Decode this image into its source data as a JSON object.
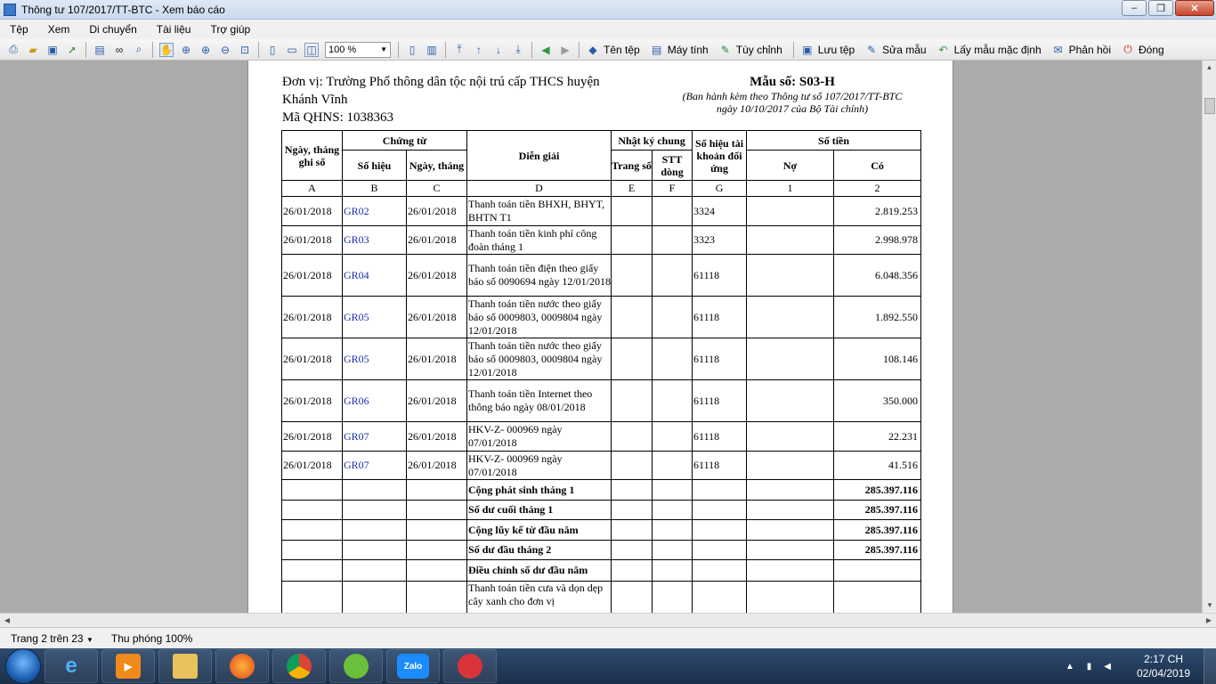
{
  "window": {
    "title": "Thông tư 107/2017/TT-BTC - Xem báo cáo",
    "minimize": "–",
    "maximize": "❐",
    "close": "✕"
  },
  "menu": [
    "Tệp",
    "Xem",
    "Di chuyển",
    "Tài liệu",
    "Trợ giúp"
  ],
  "toolbar": {
    "zoom_value": "100 %",
    "buttons": {
      "file_name": "Tên tệp",
      "computer": "Máy tính",
      "customize": "Tùy chỉnh",
      "save_file": "Lưu tệp",
      "edit_template": "Sửa mẫu",
      "default_template": "Lấy mẫu mặc định",
      "feedback": "Phản hồi",
      "close": "Đóng"
    }
  },
  "report": {
    "unit_line1": "Đơn vị: Trường Phổ thông dân tộc nội trú cấp THCS huyện",
    "unit_line2": "Khánh Vĩnh",
    "qhns": "Mã QHNS: 1038363",
    "form_no": "Mẫu số: S03-H",
    "form_note1": "(Ban hành kèm theo Thông tư số 107/2017/TT-BTC",
    "form_note2": "ngày 10/10/2017 của Bộ Tài chính)",
    "headers": {
      "date": "Ngày, tháng ghi sổ",
      "voucher": "Chứng từ",
      "voucher_no": "Số hiệu",
      "voucher_date": "Ngày, tháng",
      "description": "Diễn giải",
      "journal": "Nhật ký chung",
      "page": "Trang số",
      "stt": "STT dòng",
      "account": "Số hiệu tài khoản đối ứng",
      "amount": "Số tiền",
      "debit": "Nợ",
      "credit": "Có"
    },
    "letters": [
      "A",
      "B",
      "C",
      "D",
      "E",
      "F",
      "G",
      "1",
      "2"
    ],
    "rows": [
      {
        "date": "26/01/2018",
        "no": "GR02",
        "vdate": "26/01/2018",
        "desc": "Thanh toán tiền BHXH, BHYT, BHTN T1",
        "acc": "3324",
        "credit": "2.819.253"
      },
      {
        "date": "26/01/2018",
        "no": "GR03",
        "vdate": "26/01/2018",
        "desc": "Thanh toán tiền kinh phí công đoàn tháng 1",
        "acc": "3323",
        "credit": "2.998.978"
      },
      {
        "date": "26/01/2018",
        "no": "GR04",
        "vdate": "26/01/2018",
        "desc": "Thanh toán tiền điện theo giấy báo số 0090694 ngày 12/01/2018",
        "acc": "61118",
        "credit": "6.048.356"
      },
      {
        "date": "26/01/2018",
        "no": "GR05",
        "vdate": "26/01/2018",
        "desc": "Thanh toán tiền nước theo giấy báo số 0009803, 0009804 ngày 12/01/2018",
        "acc": "61118",
        "credit": "1.892.550"
      },
      {
        "date": "26/01/2018",
        "no": "GR05",
        "vdate": "26/01/2018",
        "desc": "Thanh toán tiền nước theo giấy báo số 0009803, 0009804 ngày 12/01/2018",
        "acc": "61118",
        "credit": "108.146"
      },
      {
        "date": "26/01/2018",
        "no": "GR06",
        "vdate": "26/01/2018",
        "desc": "Thanh toán tiền Internet theo thông báo ngày 08/01/2018",
        "acc": "61118",
        "credit": "350.000"
      },
      {
        "date": "26/01/2018",
        "no": "GR07",
        "vdate": "26/01/2018",
        "desc": "HKV-Z- 000969 ngày 07/01/2018",
        "acc": "61118",
        "credit": "22.231"
      },
      {
        "date": "26/01/2018",
        "no": "GR07",
        "vdate": "26/01/2018",
        "desc": "HKV-Z- 000969 ngày 07/01/2018",
        "acc": "61118",
        "credit": "41.516"
      }
    ],
    "summaries": [
      {
        "label": "Cộng phát sinh tháng 1",
        "credit": "285.397.116"
      },
      {
        "label": "Số dư cuối tháng 1",
        "credit": "285.397.116"
      },
      {
        "label": "Cộng lũy kế từ đầu năm",
        "credit": "285.397.116"
      },
      {
        "label": "Số dư đầu tháng 2",
        "credit": "285.397.116"
      },
      {
        "label": "Điều chỉnh số dư đầu năm",
        "credit": ""
      }
    ],
    "partial_row": {
      "desc": "Thanh toán tiền cưa và dọn dẹp cây xanh cho đơn vị"
    }
  },
  "status": {
    "page": "Trang 2 trên 23",
    "zoom": "Thu phóng 100%"
  },
  "taskbar": {
    "zalo": "Zalo",
    "time": "2:17 CH",
    "date": "02/04/2019"
  },
  "colors": {
    "voucher_link": "#1a2ea8",
    "taskbar": "#1b2f4a"
  }
}
